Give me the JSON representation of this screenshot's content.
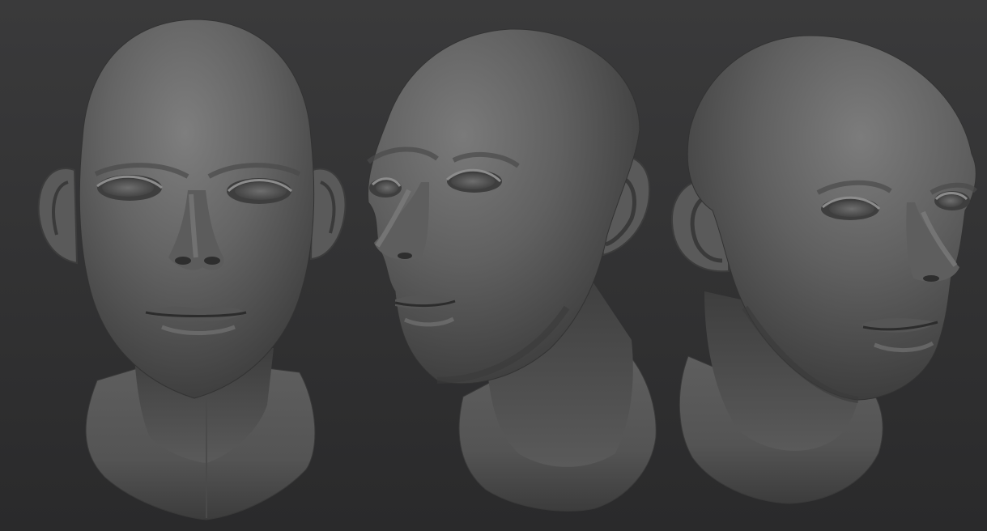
{
  "scene": {
    "background_color": "#333334",
    "clay_color": "#606060",
    "clay_highlight": "#8a8a8a",
    "clay_shadow": "#2c2c2c"
  },
  "views": [
    {
      "id": "front",
      "facing": "front"
    },
    {
      "id": "three-quarter-left",
      "facing": "three-quarter-left"
    },
    {
      "id": "three-quarter-right",
      "facing": "three-quarter-right"
    }
  ]
}
